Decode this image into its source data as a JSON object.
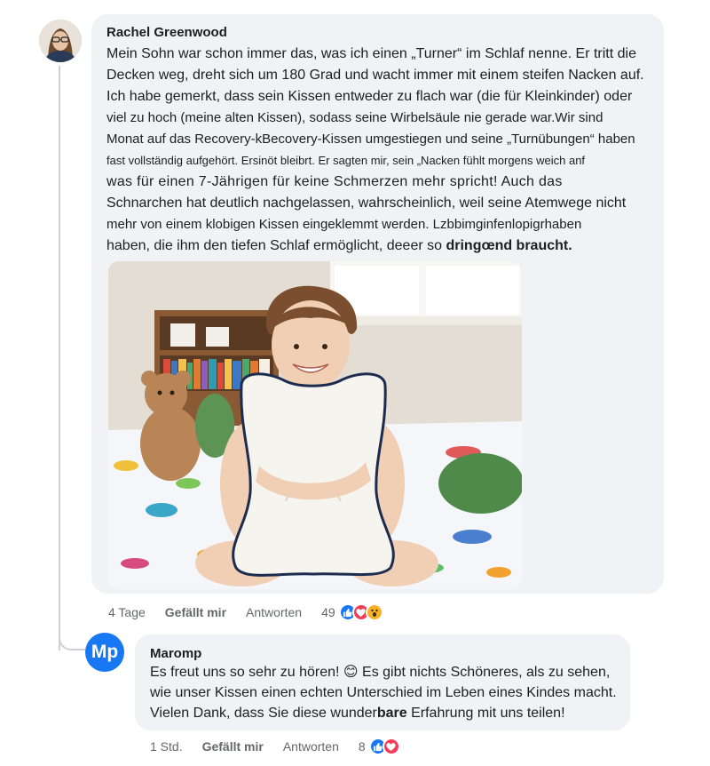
{
  "comment": {
    "author": "Rachel Greenwood",
    "text_lines": [
      "Mein Sohn war schon immer das, was ich einen „Turner“ im Schlaf nenne. Er tritt die",
      "Decken weg, dreht sich um 180 Grad und wacht immer mit einem steifen Nacken auf.",
      "Ich habe gemerkt, dass sein Kissen entweder zu flach war (die für Kleinkinder) oder",
      "viel zu hoch (meine alten Kissen), sodass seine Wirbelsäule nie gerade war.Wir sind",
      "Monat auf das Recovery-kBecovery-Kissen umgestiegen und seine „Turnübungen“ haben",
      "fast vollständig aufgehört. Ersinöt bleibrt. Er sagten mir, sein „Nacken fühlt morgens weich anf",
      "was für einen 7-Jährigen für keine Schmerzen mehr spricht! Auch das",
      "Schnarchen hat deutlich nachgelassen, wahrscheinlich, weil seine Atemwege nicht",
      "mehr von einem klobigen Kissen eingeklemmt werden. Lzbbimginfenlopigrhaben",
      "haben, die ihm den tiefen Schlaf ermöglicht, deeer so",
      "dringœnd braucht."
    ],
    "time": "4 Tage",
    "like_label": "Gefällt mir",
    "reply_label": "Antworten",
    "reaction_count": "49",
    "reactions": [
      "like-icon",
      "love-icon",
      "wow-icon"
    ]
  },
  "photo": {
    "alt": "Lächelnder Junge umarmt ein weißes Kissen auf einem Bett mit Dinosaurier-Bettwäsche und Plüschtieren"
  },
  "reply": {
    "author_initials": "Mp",
    "author": "Maromp",
    "text_line1": "Es freut uns so sehr zu hören! 😊 Es gibt nichts Schöneres, als zu sehen,",
    "text_line2": "wie unser Kissen einen echten Unterschied im Leben eines Kindes macht.",
    "text_line3a": "Vielen Dank, dass Sie diese wunder",
    "text_line3b": "bare",
    "text_line3c": " Erfahrung mit uns teilen!",
    "time": "1 Std.",
    "like_label": "Gefällt mir",
    "reply_label": "Antworten",
    "reaction_count": "8",
    "reactions": [
      "like-icon",
      "love-icon"
    ]
  },
  "colors": {
    "bubble": "#f0f2f5",
    "brand": "#1877f2",
    "love": "#f33e58",
    "wow": "#f7b125",
    "meta": "#65676b"
  }
}
